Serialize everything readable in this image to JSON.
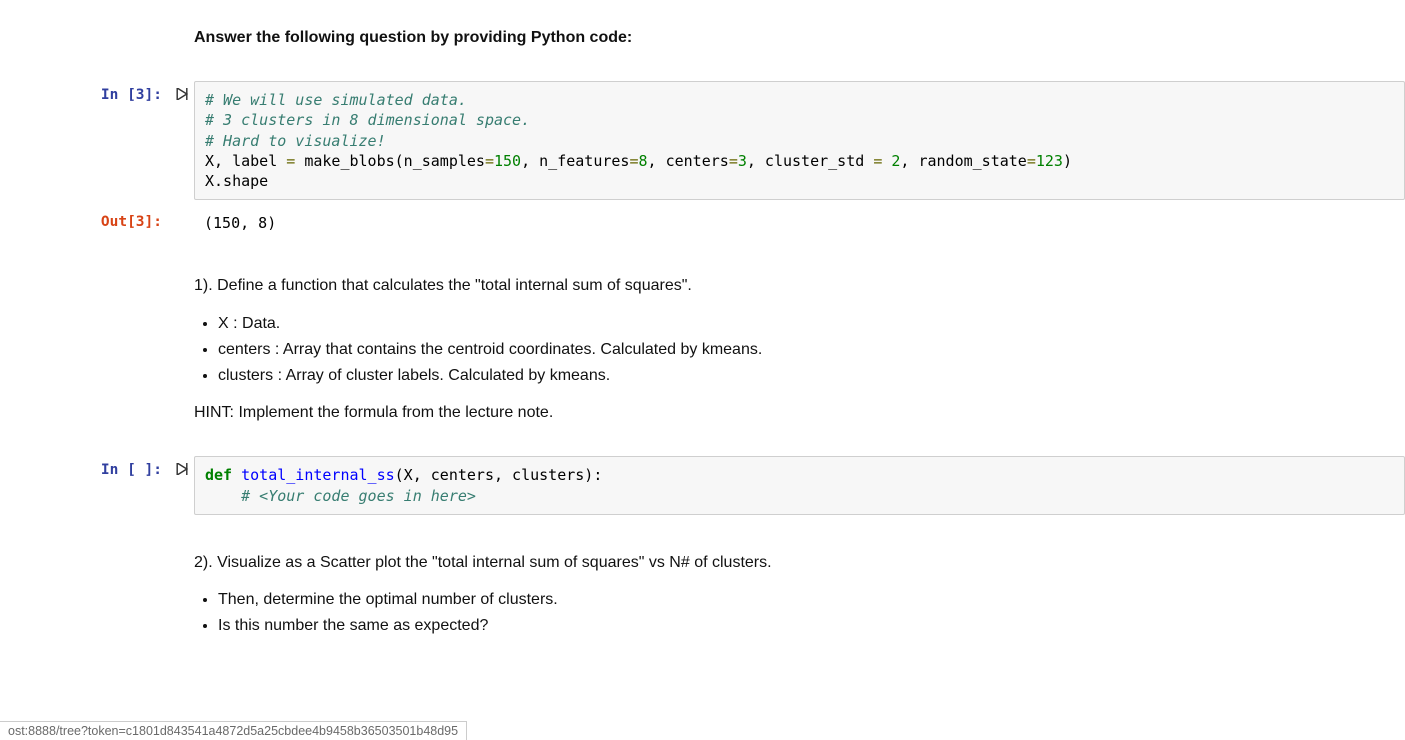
{
  "heading": "Answer the following question by providing Python code:",
  "cells": {
    "cell1": {
      "prompt_in": "In [3]:",
      "code": {
        "l1": "# We will use simulated data.",
        "l2": "# 3 clusters in 8 dimensional space.",
        "l3": "# Hard to visualize!",
        "l4a": "X, label ",
        "l4op": "=",
        "l4b": " make_blobs(n_samples",
        "l4op2": "=",
        "l4n1": "150",
        "l4c": ", n_features",
        "l4op3": "=",
        "l4n2": "8",
        "l4d": ", centers",
        "l4op4": "=",
        "l4n3": "3",
        "l4e": ", cluster_std ",
        "l4op5": "=",
        "l4sp": " ",
        "l4n4": "2",
        "l4f": ", random_state",
        "l4op6": "=",
        "l4n5": "123",
        "l4g": ")",
        "l5": "X.shape"
      },
      "prompt_out": "Out[3]:",
      "output": "(150, 8)"
    },
    "md1": {
      "p1": "1). Define a function that calculates the \"total internal sum of squares\".",
      "li1": "X : Data.",
      "li2": "centers : Array that contains the centroid coordinates. Calculated by kmeans.",
      "li3": "clusters : Array of cluster labels. Calculated by kmeans.",
      "p2": "HINT: Implement the formula from the lecture note."
    },
    "cell2": {
      "prompt_in": "In [ ]:",
      "code": {
        "kw_def": "def",
        "sp1": " ",
        "fn": "total_internal_ss",
        "sig": "(X, centers, clusters):",
        "indent": "    ",
        "comment": "# <Your code goes in here>"
      }
    },
    "md2": {
      "p1": "2). Visualize as a Scatter plot the \"total internal sum of squares\" vs N# of clusters.",
      "li1": "Then, determine the optimal number of clusters.",
      "li2": "Is this number the same as expected?"
    }
  },
  "status_url": "ost:8888/tree?token=c1801d843541a4872d5a25cbdee4b9458b36503501b48d95"
}
